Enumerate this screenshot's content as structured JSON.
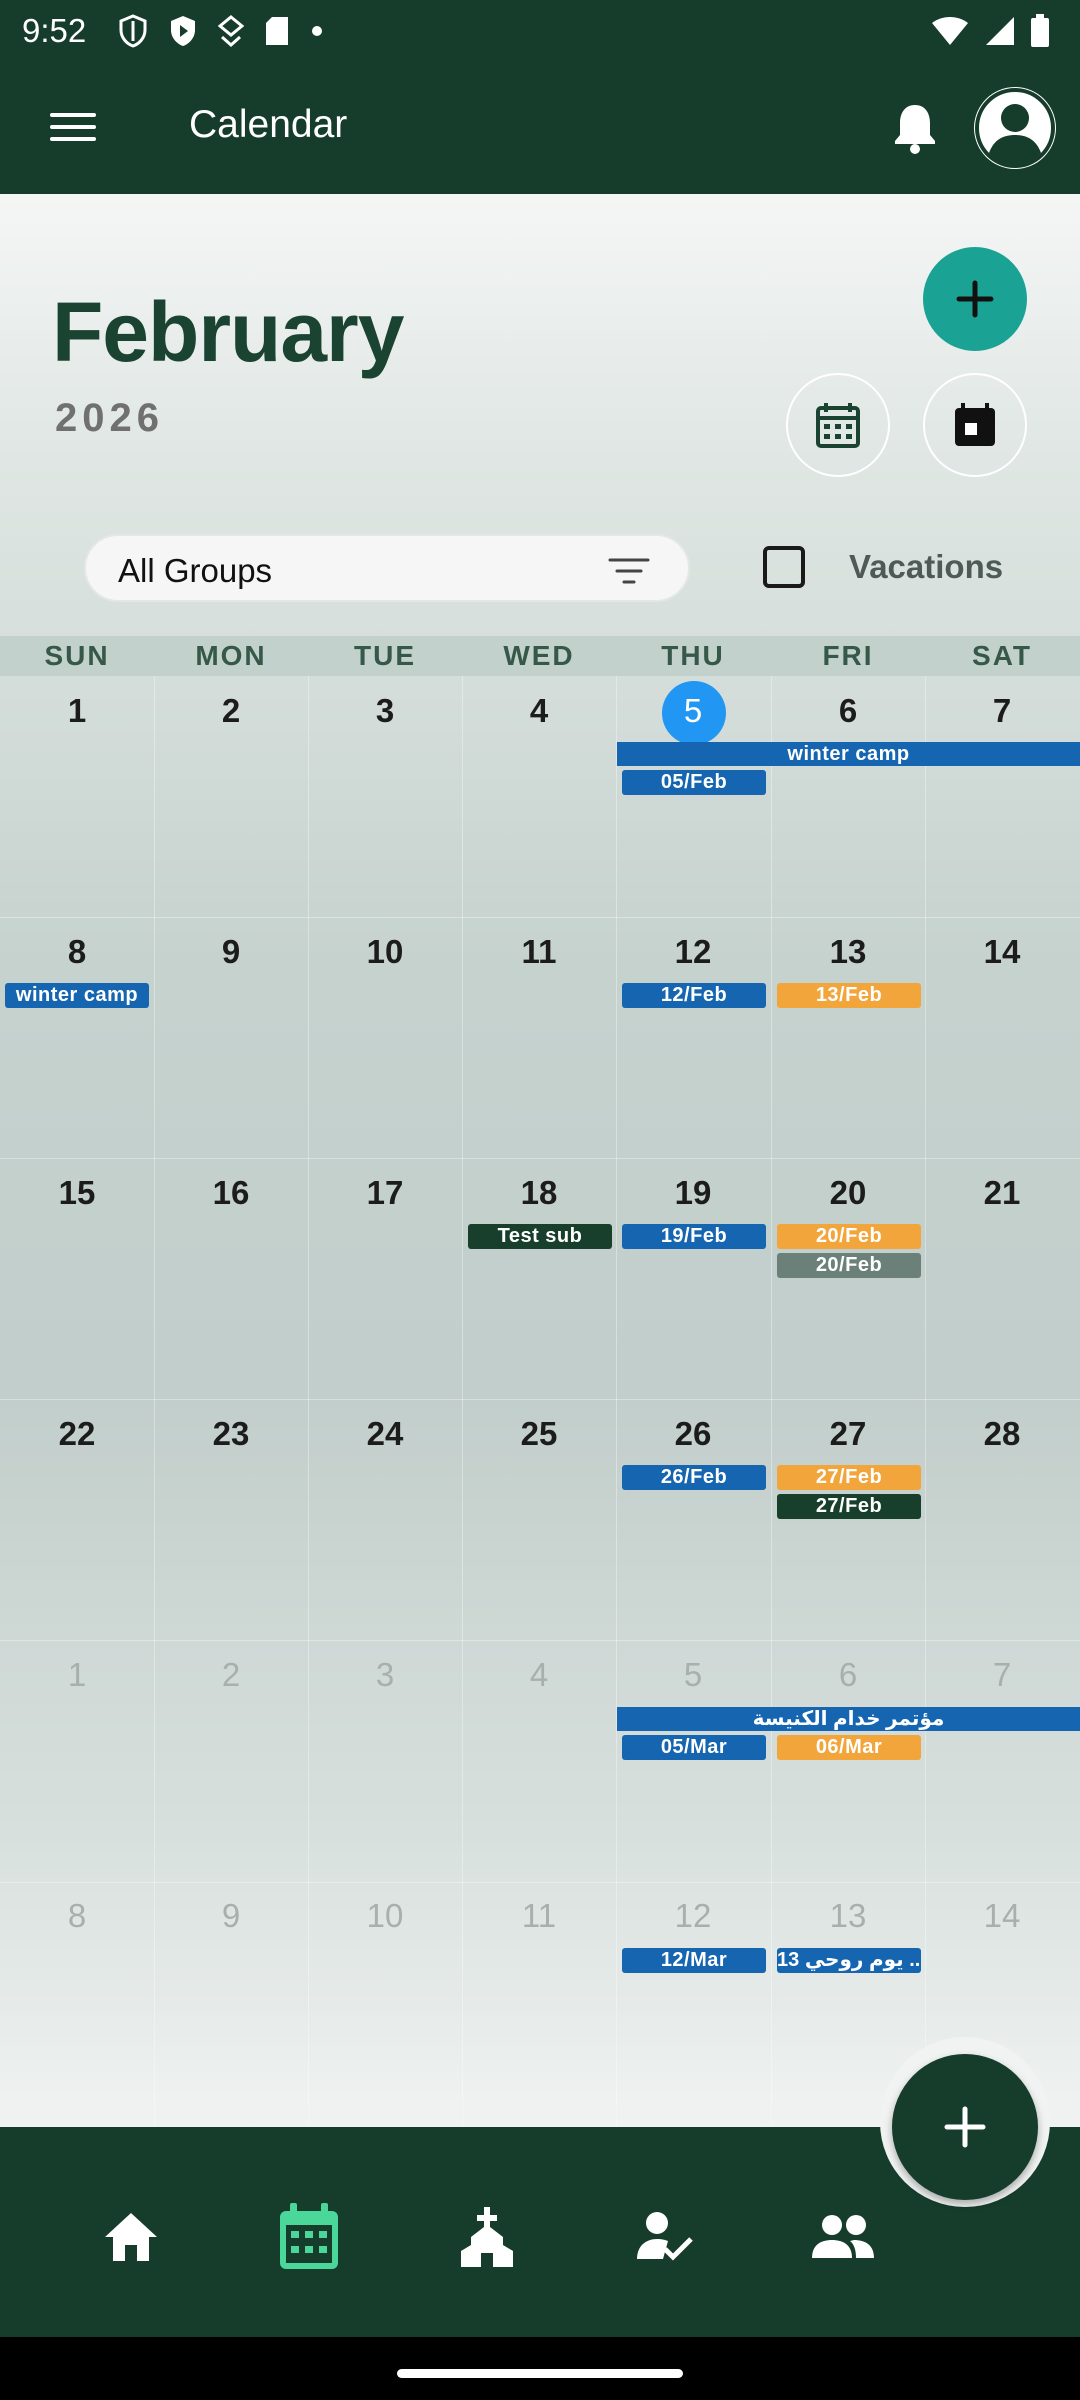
{
  "status_bar": {
    "time": "9:52"
  },
  "app_bar": {
    "title": "Calendar"
  },
  "header": {
    "month": "February",
    "year": "2026"
  },
  "filter": {
    "group_label": "All Groups",
    "vacations_label": "Vacations",
    "vacations_checked": false
  },
  "weekdays": [
    "SUN",
    "MON",
    "TUE",
    "WED",
    "THU",
    "FRI",
    "SAT"
  ],
  "weeks": [
    {
      "days": [
        "1",
        "2",
        "3",
        "4",
        "5",
        "6",
        "7"
      ],
      "other_month": false
    },
    {
      "days": [
        "8",
        "9",
        "10",
        "11",
        "12",
        "13",
        "14"
      ],
      "other_month": false
    },
    {
      "days": [
        "15",
        "16",
        "17",
        "18",
        "19",
        "20",
        "21"
      ],
      "other_month": false
    },
    {
      "days": [
        "22",
        "23",
        "24",
        "25",
        "26",
        "27",
        "28"
      ],
      "other_month": false
    },
    {
      "days": [
        "1",
        "2",
        "3",
        "4",
        "5",
        "6",
        "7"
      ],
      "other_month": true
    },
    {
      "days": [
        "8",
        "9",
        "10",
        "11",
        "12",
        "13",
        "14"
      ],
      "other_month": true
    }
  ],
  "today": "5",
  "events": {
    "w1_winter_camp": "winter camp",
    "w1_thu": "05/Feb",
    "w2_sun_winter_camp": "winter camp",
    "w2_thu": "12/Feb",
    "w2_fri": "13/Feb",
    "w3_wed": "Test sub",
    "w3_thu": "19/Feb",
    "w3_fri_1": "20/Feb",
    "w3_fri_2": "20/Feb",
    "w4_thu": "26/Feb",
    "w4_fri_1": "27/Feb",
    "w4_fri_2": "27/Feb",
    "w5_conference": "مؤتمر خدام الكنيسة",
    "w5_thu": "05/Mar",
    "w5_fri": "06/Mar",
    "w6_thu": "12/Mar",
    "w6_fri": "13 يوم روحي ..."
  },
  "colors": {
    "primary_dark": "#163c2b",
    "accent_teal": "#1aa394",
    "today_blue": "#2196f3",
    "event_blue": "#1565b0",
    "event_orange": "#f2a53b",
    "event_dark_green": "#173f2c",
    "event_gray": "#6b8079",
    "nav_active": "#4bd69a"
  },
  "bottom_nav": {
    "items": [
      {
        "icon": "home-icon",
        "active": false
      },
      {
        "icon": "calendar-icon",
        "active": true
      },
      {
        "icon": "church-icon",
        "active": false
      },
      {
        "icon": "person-check-icon",
        "active": false
      },
      {
        "icon": "people-icon",
        "active": false
      }
    ]
  }
}
